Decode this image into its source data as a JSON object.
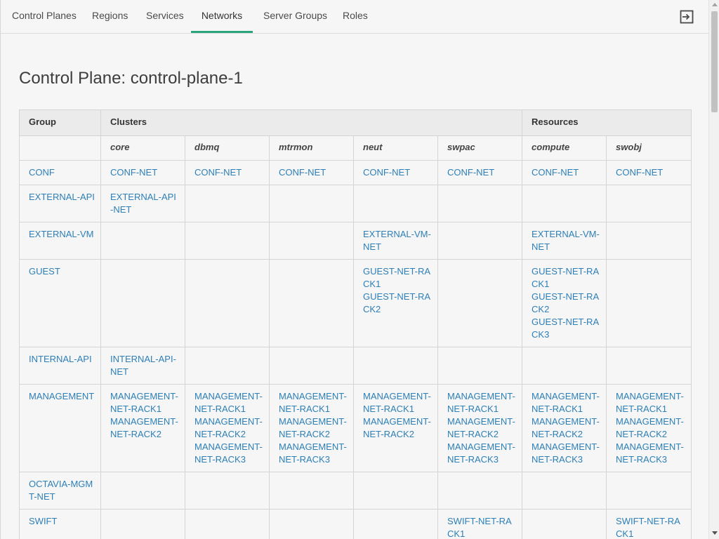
{
  "nav": {
    "tabs": [
      {
        "label": "Control Planes"
      },
      {
        "label": "Regions"
      },
      {
        "label": "Services"
      },
      {
        "label": "Networks"
      },
      {
        "label": "Server Groups"
      },
      {
        "label": "Roles"
      }
    ],
    "active_tab": "Networks",
    "logout_icon": "logout-icon",
    "accent_color": "#2aa57e"
  },
  "page": {
    "title": "Control Plane: control-plane-1"
  },
  "table": {
    "header1": {
      "group": "Group",
      "clusters": "Clusters",
      "resources": "Resources"
    },
    "subheaders": [
      "core",
      "dbmq",
      "mtrmon",
      "neut",
      "swpac",
      "compute",
      "swobj"
    ],
    "link_color": "#2d7fb8",
    "rows": [
      {
        "group": "CONF",
        "cells": [
          [
            "CONF-NET"
          ],
          [
            "CONF-NET"
          ],
          [
            "CONF-NET"
          ],
          [
            "CONF-NET"
          ],
          [
            "CONF-NET"
          ],
          [
            "CONF-NET"
          ],
          [
            "CONF-NET"
          ]
        ]
      },
      {
        "group": "EXTERNAL-API",
        "cells": [
          [
            "EXTERNAL-API-NET"
          ],
          [],
          [],
          [],
          [],
          [],
          []
        ]
      },
      {
        "group": "EXTERNAL-VM",
        "cells": [
          [],
          [],
          [],
          [
            "EXTERNAL-VM-NET"
          ],
          [],
          [
            "EXTERNAL-VM-NET"
          ],
          []
        ]
      },
      {
        "group": "GUEST",
        "cells": [
          [],
          [],
          [],
          [
            "GUEST-NET-RACK1",
            "GUEST-NET-RACK2"
          ],
          [],
          [
            "GUEST-NET-RACK1",
            "GUEST-NET-RACK2",
            "GUEST-NET-RACK3"
          ],
          []
        ]
      },
      {
        "group": "INTERNAL-API",
        "cells": [
          [
            "INTERNAL-API-NET"
          ],
          [],
          [],
          [],
          [],
          [],
          []
        ]
      },
      {
        "group": "MANAGEMENT",
        "cells": [
          [
            "MANAGEMENT-NET-RACK1",
            "MANAGEMENT-NET-RACK2"
          ],
          [
            "MANAGEMENT-NET-RACK1",
            "MANAGEMENT-NET-RACK2",
            "MANAGEMENT-NET-RACK3"
          ],
          [
            "MANAGEMENT-NET-RACK1",
            "MANAGEMENT-NET-RACK2",
            "MANAGEMENT-NET-RACK3"
          ],
          [
            "MANAGEMENT-NET-RACK1",
            "MANAGEMENT-NET-RACK2"
          ],
          [
            "MANAGEMENT-NET-RACK1",
            "MANAGEMENT-NET-RACK2",
            "MANAGEMENT-NET-RACK3"
          ],
          [
            "MANAGEMENT-NET-RACK1",
            "MANAGEMENT-NET-RACK2",
            "MANAGEMENT-NET-RACK3"
          ],
          [
            "MANAGEMENT-NET-RACK1",
            "MANAGEMENT-NET-RACK2",
            "MANAGEMENT-NET-RACK3"
          ]
        ]
      },
      {
        "group": "OCTAVIA-MGMT-NET",
        "cells": [
          [],
          [],
          [],
          [],
          [],
          [],
          []
        ]
      },
      {
        "group": "SWIFT",
        "cells": [
          [],
          [],
          [],
          [],
          [
            "SWIFT-NET-RACK1"
          ],
          [],
          [
            "SWIFT-NET-RACK1"
          ]
        ]
      }
    ]
  }
}
